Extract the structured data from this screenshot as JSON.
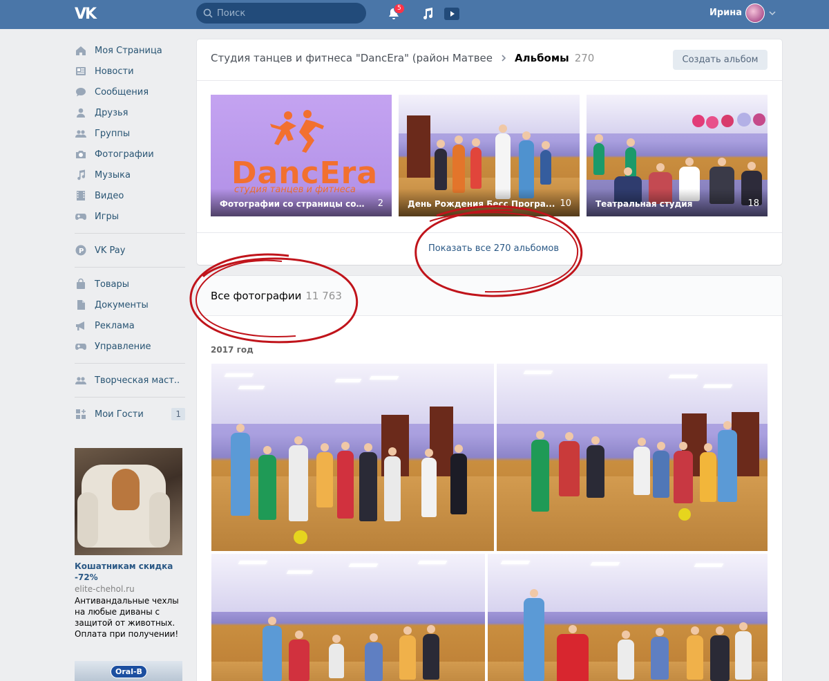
{
  "header": {
    "logo": "VK",
    "search_placeholder": "Поиск",
    "notifications_count": "5",
    "user_name": "Ирина"
  },
  "sidebar": {
    "items": [
      {
        "label": "Моя Страница",
        "icon": "home-icon"
      },
      {
        "label": "Новости",
        "icon": "news-icon"
      },
      {
        "label": "Сообщения",
        "icon": "messages-icon"
      },
      {
        "label": "Друзья",
        "icon": "friend-icon"
      },
      {
        "label": "Группы",
        "icon": "groups-icon"
      },
      {
        "label": "Фотографии",
        "icon": "camera-icon"
      },
      {
        "label": "Музыка",
        "icon": "music-note-icon"
      },
      {
        "label": "Видео",
        "icon": "film-icon"
      },
      {
        "label": "Игры",
        "icon": "gamepad-icon"
      }
    ],
    "pay": {
      "label": "VK Pay",
      "icon": "vkpay-icon"
    },
    "items2": [
      {
        "label": "Товары",
        "icon": "shopping-bag-icon"
      },
      {
        "label": "Документы",
        "icon": "document-icon"
      },
      {
        "label": "Реклама",
        "icon": "megaphone-icon"
      },
      {
        "label": "Управление",
        "icon": "gamepad-icon"
      }
    ],
    "group": {
      "label": "Творческая маст..",
      "icon": "people-icon"
    },
    "guests": {
      "label": "Мои Гости",
      "icon": "apps-icon",
      "count": "1"
    }
  },
  "ad": {
    "title": "Кошатникам скидка -72%",
    "domain": "elite-chehol.ru",
    "text": "Антивандальные чехлы на любые диваны с защитой от животных. Оплата при получении!",
    "second_ad_logo": "Oral-B"
  },
  "albums": {
    "group_name": "Студия танцев и фитнеса \"DancEra\" (район Матвее",
    "section_title": "Альбомы",
    "section_count": "270",
    "create_button": "Создать альбом",
    "items": [
      {
        "title": "Фотографии со страницы сообщ...",
        "count": "2",
        "logo": "DancEra",
        "logo_sub": "студия танцев и фитнеса"
      },
      {
        "title": "День Рождения Бесс Програ...",
        "count": "10"
      },
      {
        "title": "Театральная студия",
        "count": "18"
      }
    ],
    "show_all": "Показать все 270 альбомов"
  },
  "photos": {
    "title": "Все фотографии",
    "count": "11 763",
    "year": "2017 год"
  },
  "colors": {
    "header": "#4a76a8",
    "link": "#2a5885",
    "annotation": "#c0141b"
  }
}
